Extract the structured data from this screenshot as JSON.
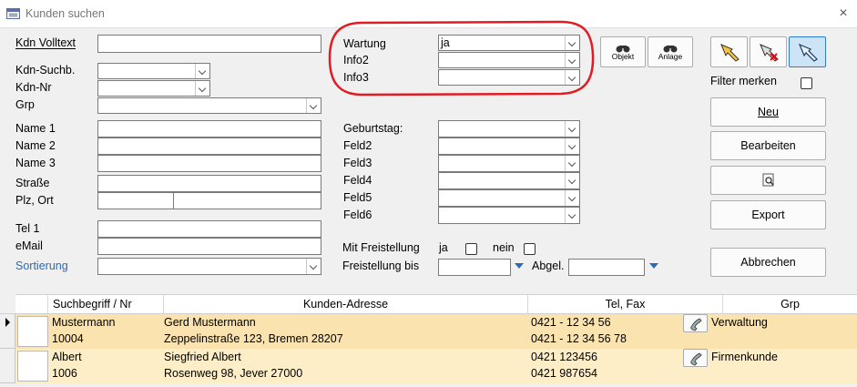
{
  "window": {
    "title": "Kunden suchen"
  },
  "labels": {
    "kdn_volltext": "Kdn Volltext",
    "kdn_suchb": "Kdn-Suchb.",
    "kdn_nr": "Kdn-Nr",
    "grp": "Grp",
    "name1": "Name 1",
    "name2": "Name 2",
    "name3": "Name 3",
    "strasse": "Straße",
    "plz_ort": "Plz,  Ort",
    "tel1": "Tel 1",
    "email": "eMail",
    "sortierung": "Sortierung",
    "wartung": "Wartung",
    "info2": "Info2",
    "info3": "Info3",
    "geburtstag": "Geburtstag:",
    "feld2": "Feld2",
    "feld3": "Feld3",
    "feld4": "Feld4",
    "feld5": "Feld5",
    "feld6": "Feld6",
    "mit_freistellung": "Mit Freistellung",
    "ja": "ja",
    "nein": "nein",
    "freistellung_bis": "Freistellung bis",
    "abgel": "Abgel.",
    "filter_merken": "Filter merken"
  },
  "fields": {
    "wartung_value": "ja"
  },
  "buttons": {
    "objekt": "Objekt",
    "anlage": "Anlage",
    "neu": "Neu",
    "bearbeiten": "Bearbeiten",
    "export": "Export",
    "abbrechen": "Abbrechen"
  },
  "grid": {
    "headers": [
      "Suchbegriff /  Nr",
      "Kunden-Adresse",
      "Tel, Fax",
      "Grp"
    ],
    "rows": [
      {
        "suchbegriff": "Mustermann",
        "nr": "10004",
        "name": "Gerd Mustermann",
        "adresse": "Zeppelinstraße 123, Bremen 28207",
        "tel": "0421 - 12 34 56",
        "fax": "0421 - 12 34 56 78",
        "grp": "Verwaltung"
      },
      {
        "suchbegriff": "Albert",
        "nr": "1006",
        "name": "Siegfried Albert",
        "adresse": "Rosenweg 98, Jever 27000",
        "tel": "0421 123456",
        "fax": "0421 987654",
        "grp": "Firmenkunde"
      }
    ]
  },
  "colors": {
    "highlight_circle": "#e01b24",
    "row_bg": "#fdeec8",
    "link_blue": "#2b6cb0"
  }
}
